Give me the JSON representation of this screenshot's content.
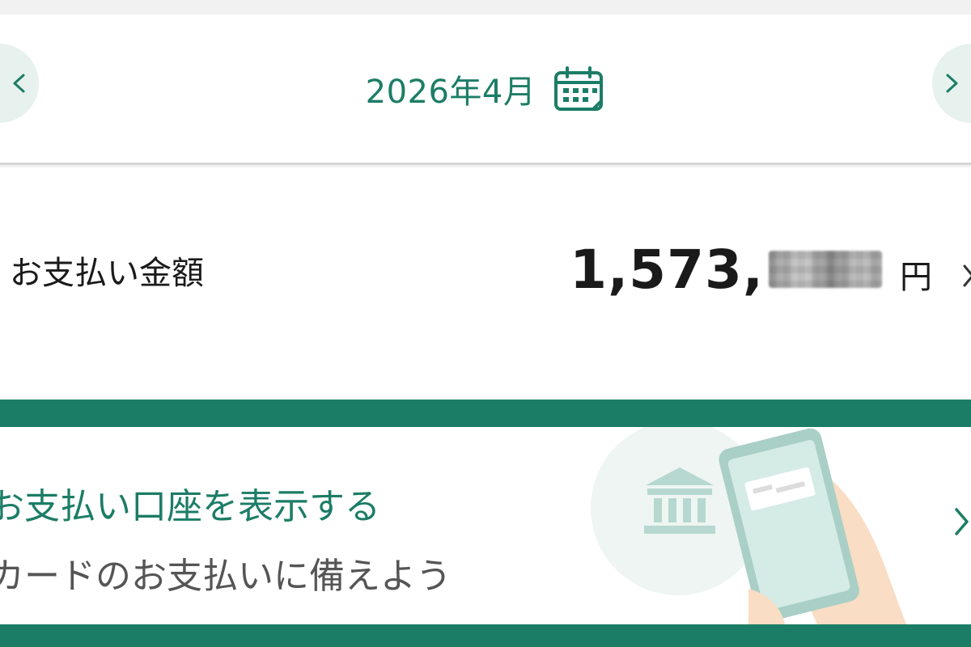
{
  "header": {
    "month": "2026年4月",
    "prev_icon": "chevron-left-icon",
    "next_icon": "chevron-right-icon",
    "calendar_icon": "calendar-icon"
  },
  "payment": {
    "label": "お支払い金額",
    "amount_visible": "1,573,",
    "currency": "円"
  },
  "promo": {
    "title": "お支払い口座を表示する",
    "subtitle": "カードのお支払いに備えよう",
    "illustration_icons": [
      "bank-icon",
      "smartphone-icon",
      "hand-icon"
    ]
  },
  "colors": {
    "accent": "#1c7d66",
    "light_accent": "#e7f1ee",
    "text": "#1a1a1a",
    "subtext": "#555555"
  }
}
